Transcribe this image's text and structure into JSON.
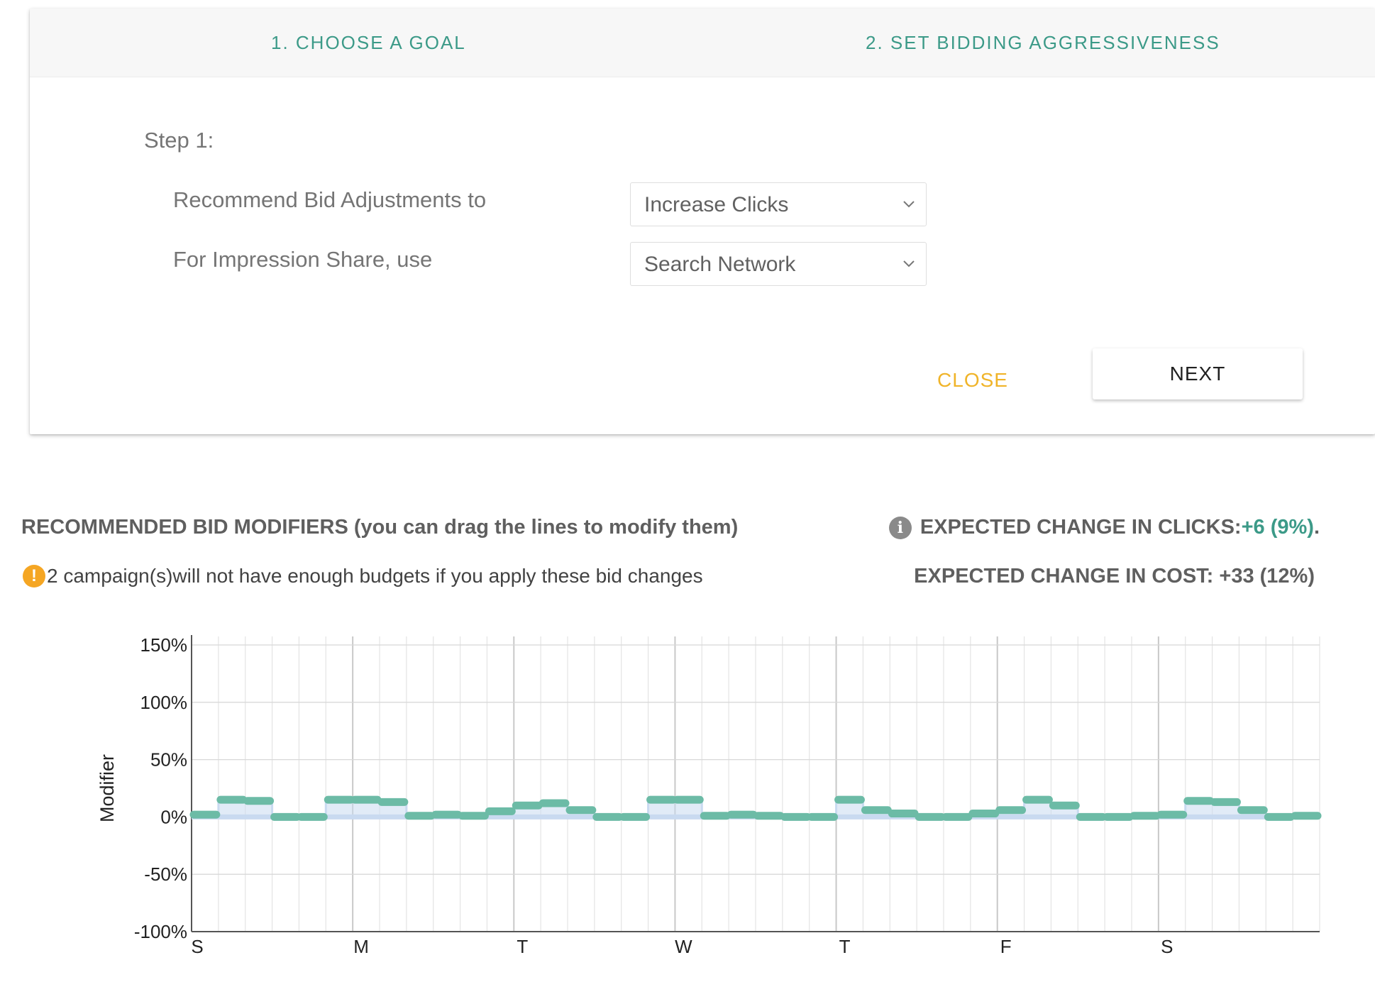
{
  "wizard": {
    "steps": [
      "1. CHOOSE A GOAL",
      "2. SET BIDDING AGGRESSIVENESS"
    ],
    "step_label": "Step 1:",
    "bid_adjust_label": "Recommend Bid Adjustments to",
    "bid_adjust_value": "Increase Clicks",
    "impression_label": "For Impression Share, use",
    "impression_value": "Search Network",
    "close_label": "CLOSE",
    "next_label": "NEXT"
  },
  "summary": {
    "title": "RECOMMENDED BID MODIFIERS (you can drag the lines to modify them)",
    "warning": "2 campaign(s)will not have enough budgets if you apply these bid changes",
    "clicks_label": "EXPECTED CHANGE IN CLICKS: ",
    "clicks_value": "+6 (9%)",
    "clicks_suffix": ".",
    "cost_text": "EXPECTED CHANGE IN COST: +33 (12%)"
  },
  "icons": {
    "info": "info-icon",
    "warning": "warning-icon",
    "dropdown": "chevron-down-icon"
  },
  "colors": {
    "accent": "#3c9a88",
    "close": "#f0b429",
    "modifier_line": "#6cbba6",
    "baseline_fill": "#c9daf0"
  },
  "chart_data": {
    "type": "line",
    "ylabel": "Modifier",
    "ylim": [
      -100,
      150
    ],
    "yticks": [
      "150%",
      "100%",
      "50%",
      "0%",
      "-50%",
      "-100%"
    ],
    "ytick_values": [
      150,
      100,
      50,
      0,
      -50,
      -100
    ],
    "day_labels": [
      "S",
      "M",
      "T",
      "W",
      "T",
      "F",
      "S"
    ],
    "grid": true,
    "series": [
      {
        "values": [
          2,
          15,
          14,
          0,
          0,
          15,
          15,
          13,
          1,
          2,
          1,
          5,
          10,
          12,
          6,
          0,
          0,
          15,
          15,
          1,
          2,
          1,
          0,
          0,
          15,
          6,
          3,
          0,
          0,
          3,
          6,
          15,
          10,
          0,
          0,
          1,
          2,
          14,
          13,
          6,
          0,
          1
        ]
      }
    ]
  }
}
